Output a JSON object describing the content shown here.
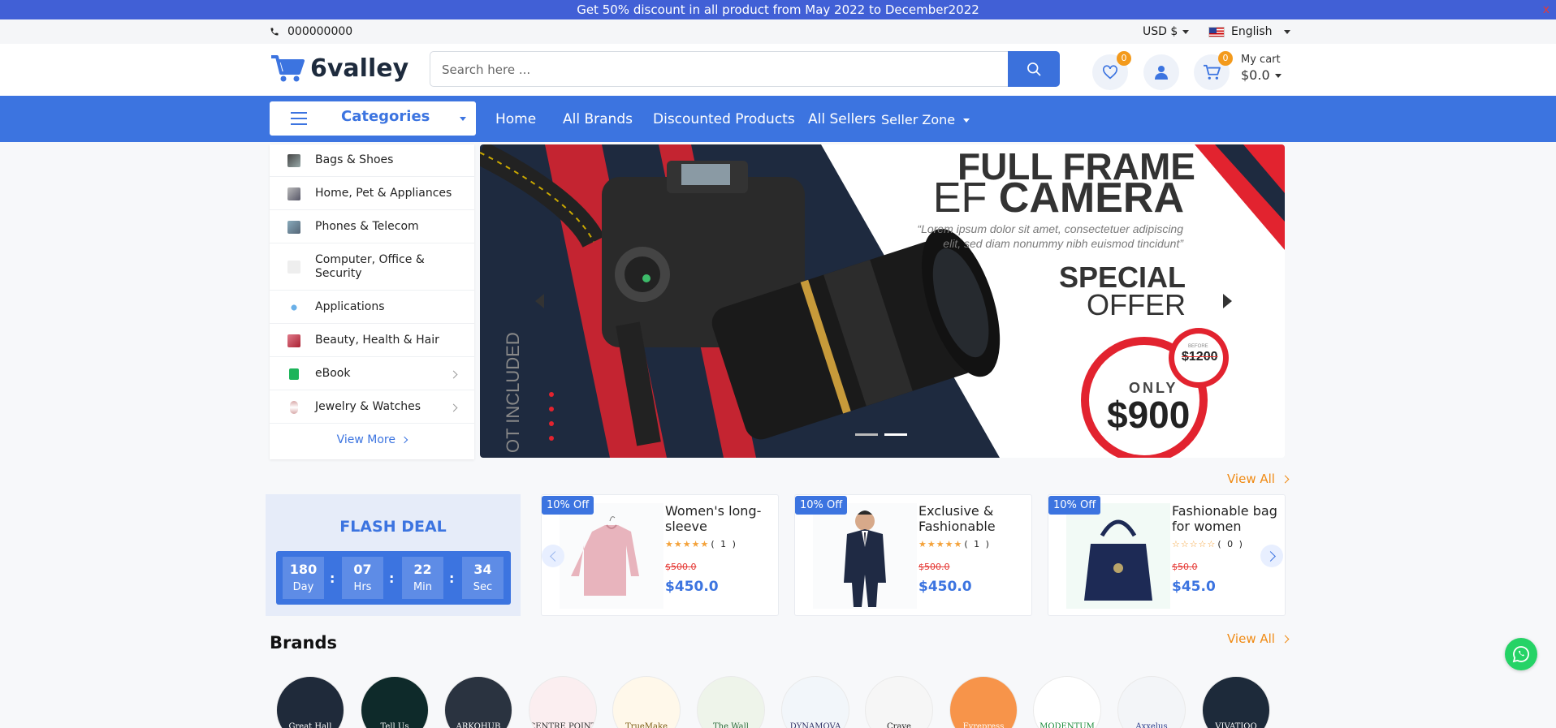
{
  "announcement": {
    "text": "Get 50% discount in all product from May 2022 to December2022",
    "close": "x"
  },
  "topbar": {
    "phone": "000000000",
    "currency": "USD $",
    "language": "English"
  },
  "header": {
    "logo_text": "6valley",
    "search_placeholder": "Search here ...",
    "wishlist_count": "0",
    "cart_count": "0",
    "cart_label": "My cart",
    "cart_total": "$0.0"
  },
  "nav": {
    "categories_label": "Categories",
    "links": [
      "Home",
      "All Brands",
      "Discounted Products",
      "All Sellers",
      "Seller Zone"
    ]
  },
  "categories": {
    "items": [
      {
        "label": "Bags & Shoes",
        "icon": "bag-icon",
        "has_sub": false
      },
      {
        "label": "Home, Pet & Appliances",
        "icon": "appliance-icon",
        "has_sub": false
      },
      {
        "label": "Phones & Telecom",
        "icon": "phone-icon",
        "has_sub": false
      },
      {
        "label": "Computer, Office & Security",
        "icon": "computer-icon",
        "has_sub": false
      },
      {
        "label": "Applications",
        "icon": "applications-icon",
        "has_sub": false
      },
      {
        "label": "Beauty, Health & Hair",
        "icon": "beauty-icon",
        "has_sub": false
      },
      {
        "label": "eBook",
        "icon": "ebook-icon",
        "has_sub": true
      },
      {
        "label": "Jewelry & Watches",
        "icon": "watch-icon",
        "has_sub": true
      }
    ],
    "view_more": "View More"
  },
  "banner": {
    "title_line1": "FULL FRAME",
    "title_line2_a": "EF",
    "title_line2_b": "CAMERA",
    "lorem": "“Lorem ipsum dolor sit amet, consectetuer adipiscing elit, sed diam nonummy nibh euismod tincidunt”",
    "special": "SPECIAL",
    "offer": "OFFER",
    "only": "ONLY",
    "price": "$900",
    "before_label": "BEFORE",
    "was_price": "$1200",
    "side_text": "OT INCLUDED",
    "slide_count": 2,
    "active_slide": 2
  },
  "flash_deal": {
    "view_all": "View All",
    "title": "FLASH DEAL",
    "timer": [
      {
        "value": "180",
        "unit": "Day"
      },
      {
        "value": "07",
        "unit": "Hrs"
      },
      {
        "value": "22",
        "unit": "Min"
      },
      {
        "value": "34",
        "unit": "Sec"
      }
    ],
    "products": [
      {
        "discount": "10% Off",
        "name": "Women's long-sleeve",
        "stars": "★★★★★",
        "rating_count": "( 1 )",
        "old_price": "$500.0",
        "price": "$450.0",
        "image": "pink-sweater"
      },
      {
        "discount": "10% Off",
        "name": "Exclusive & Fashionable",
        "stars": "★★★★★",
        "rating_count": "( 1 )",
        "old_price": "$500.0",
        "price": "$450.0",
        "image": "suit"
      },
      {
        "discount": "10% Off",
        "name": "Fashionable bag for women",
        "stars": "☆☆☆☆☆",
        "rating_count": "( 0 )",
        "old_price": "$50.0",
        "price": "$45.0",
        "image": "handbag"
      }
    ]
  },
  "brands": {
    "title": "Brands",
    "view_all": "View All",
    "items": [
      {
        "name": "Great Hall",
        "bg": "#1f2a3a",
        "fg": "#ffffff"
      },
      {
        "name": "Tell Us",
        "bg": "#0e2a2a",
        "fg": "#ffffff"
      },
      {
        "name": "ARKOHUB",
        "bg": "#2a3340",
        "fg": "#ffffff"
      },
      {
        "name": "CENTRE POINT",
        "bg": "#fbeef0",
        "fg": "#333333"
      },
      {
        "name": "TrueMake",
        "bg": "#fff8ea",
        "fg": "#7a5a10"
      },
      {
        "name": "The Wall",
        "bg": "#eef4ea",
        "fg": "#2a6a3a"
      },
      {
        "name": "DYNAMOVA",
        "bg": "#f2f6fa",
        "fg": "#333366"
      },
      {
        "name": "Crave",
        "bg": "#f6f6f6",
        "fg": "#222222"
      },
      {
        "name": "Fyrepress",
        "bg": "#f7944a",
        "fg": "#ffffff"
      },
      {
        "name": "MODENTUM",
        "bg": "#ffffff",
        "fg": "#1a8a3a"
      },
      {
        "name": "Axxelus",
        "bg": "#f3f5f8",
        "fg": "#2a3a8a"
      },
      {
        "name": "VIVATIOO",
        "bg": "#1d2a3a",
        "fg": "#ffffff"
      }
    ]
  },
  "colors": {
    "primary": "#3c74e0",
    "announcement": "#4160d6",
    "accent": "#f08a13"
  }
}
